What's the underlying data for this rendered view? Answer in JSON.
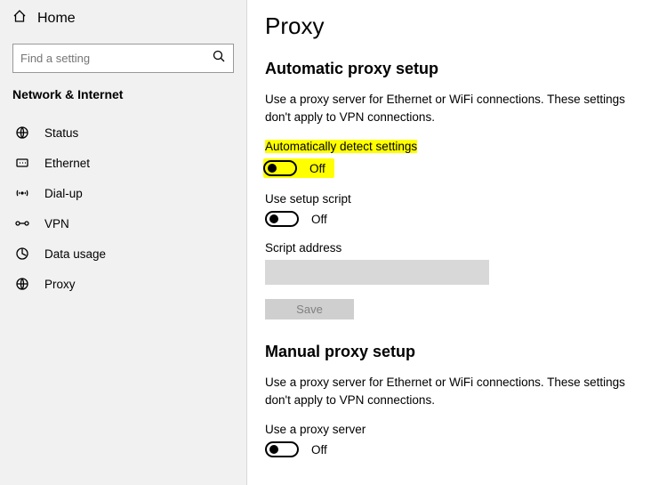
{
  "sidebar": {
    "home_label": "Home",
    "search_placeholder": "Find a setting",
    "section_title": "Network & Internet",
    "items": [
      {
        "label": "Status"
      },
      {
        "label": "Ethernet"
      },
      {
        "label": "Dial-up"
      },
      {
        "label": "VPN"
      },
      {
        "label": "Data usage"
      },
      {
        "label": "Proxy"
      }
    ]
  },
  "main": {
    "page_title": "Proxy",
    "automatic": {
      "heading": "Automatic proxy setup",
      "description": "Use a proxy server for Ethernet or WiFi connections. These settings don't apply to VPN connections.",
      "auto_detect_label": "Automatically detect settings",
      "auto_detect_state": "Off",
      "use_script_label": "Use setup script",
      "use_script_state": "Off",
      "script_address_label": "Script address",
      "script_address_value": "",
      "save_button": "Save"
    },
    "manual": {
      "heading": "Manual proxy setup",
      "description": "Use a proxy server for Ethernet or WiFi connections. These settings don't apply to VPN connections.",
      "use_proxy_label": "Use a proxy server",
      "use_proxy_state": "Off"
    }
  }
}
